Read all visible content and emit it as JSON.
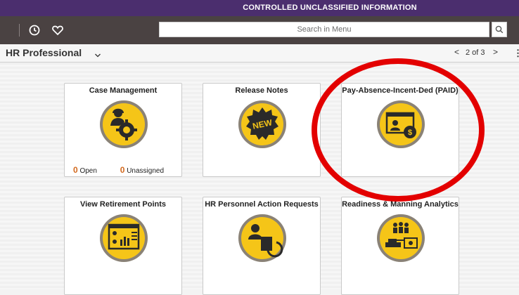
{
  "banner": "CONTROLLED UNCLASSIFIED INFORMATION",
  "topbar": {
    "icons": [
      "history-icon",
      "favorites-icon"
    ],
    "search": {
      "placeholder": "Search in Menu",
      "icon": "search-icon"
    }
  },
  "header": {
    "title": "HR Professional",
    "pager": "2 of 3",
    "prev": "<",
    "next": ">",
    "more": "⋮"
  },
  "tiles": [
    {
      "title": "Case Management",
      "icon": "case-management-icon",
      "counts": {
        "open_value": "0",
        "open_label": "Open",
        "unassigned_value": "0",
        "unassigned_label": "Unassigned"
      }
    },
    {
      "title": "Release Notes",
      "icon": "new-badge-icon"
    },
    {
      "title": "Pay-Absence-Incent-Ded (PAID)",
      "icon": "pay-dashboard-icon"
    },
    {
      "title": "View Retirement Points",
      "icon": "retirement-points-icon"
    },
    {
      "title": "HR Personnel Action Requests",
      "icon": "personnel-action-icon"
    },
    {
      "title": "Readiness & Manning Analytics",
      "icon": "readiness-analytics-icon"
    }
  ],
  "colors": {
    "banner": "#4b2e6e",
    "topbar": "#4a4242",
    "tile_icon": "#f5c518",
    "annotation": "#e30000"
  }
}
